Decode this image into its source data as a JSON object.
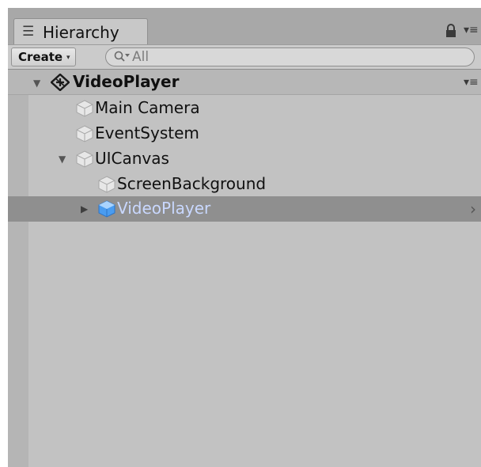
{
  "window": {
    "tab_label": "Hierarchy",
    "tab_icon": "hierarchy-list-icon",
    "lock_icon": "lock-icon",
    "menu_icon": "context-menu-icon"
  },
  "toolbar": {
    "create_label": "Create",
    "create_arrow": "▾",
    "search_placeholder": "All",
    "search_icon": "search-filter-icon"
  },
  "scene": {
    "name": "VideoPlayer",
    "icon": "unity-scene-icon",
    "menu_icon": "scene-menu-icon",
    "expanded": true
  },
  "tree": {
    "items": [
      {
        "label": "Main Camera",
        "depth": 1,
        "expanded": null,
        "selected": false
      },
      {
        "label": "EventSystem",
        "depth": 1,
        "expanded": null,
        "selected": false
      },
      {
        "label": "UICanvas",
        "depth": 1,
        "expanded": true,
        "selected": false
      },
      {
        "label": "ScreenBackground",
        "depth": 2,
        "expanded": null,
        "selected": false
      },
      {
        "label": "VideoPlayer",
        "depth": 2,
        "expanded": false,
        "selected": true
      }
    ]
  },
  "colors": {
    "panel_bg": "#c2c2c2",
    "selection_bg": "#8f8f8f",
    "selection_text": "#c9d8ff",
    "prefab_blue": "#3a8ee6"
  }
}
